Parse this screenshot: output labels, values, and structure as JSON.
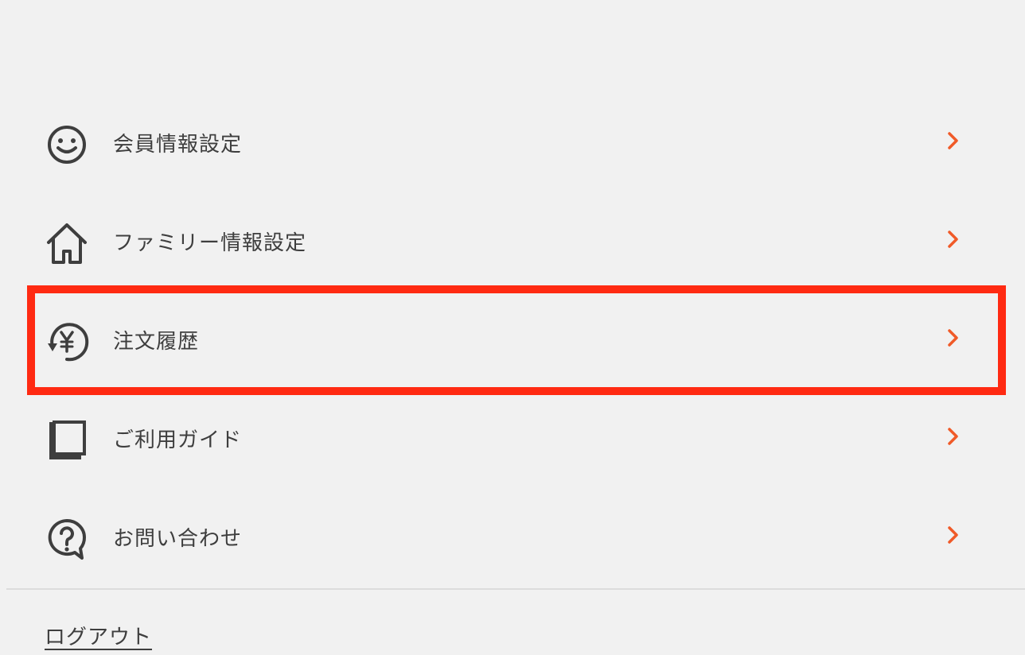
{
  "menu": {
    "items": [
      {
        "label": "会員情報設定",
        "icon": "smiley-icon"
      },
      {
        "label": "ファミリー情報設定",
        "icon": "house-icon"
      },
      {
        "label": "注文履歴",
        "icon": "yen-history-icon"
      },
      {
        "label": "ご利用ガイド",
        "icon": "book-icon"
      },
      {
        "label": "お問い合わせ",
        "icon": "question-bubble-icon"
      }
    ],
    "highlighted_item": "注文履歴"
  },
  "logout": {
    "label": "ログアウト"
  },
  "colors": {
    "background": "#f1f1f1",
    "text": "#3e3e3e",
    "chevron_accent": "#f05a28",
    "highlight_border": "#ff2a12",
    "divider": "#dcdcdc"
  }
}
